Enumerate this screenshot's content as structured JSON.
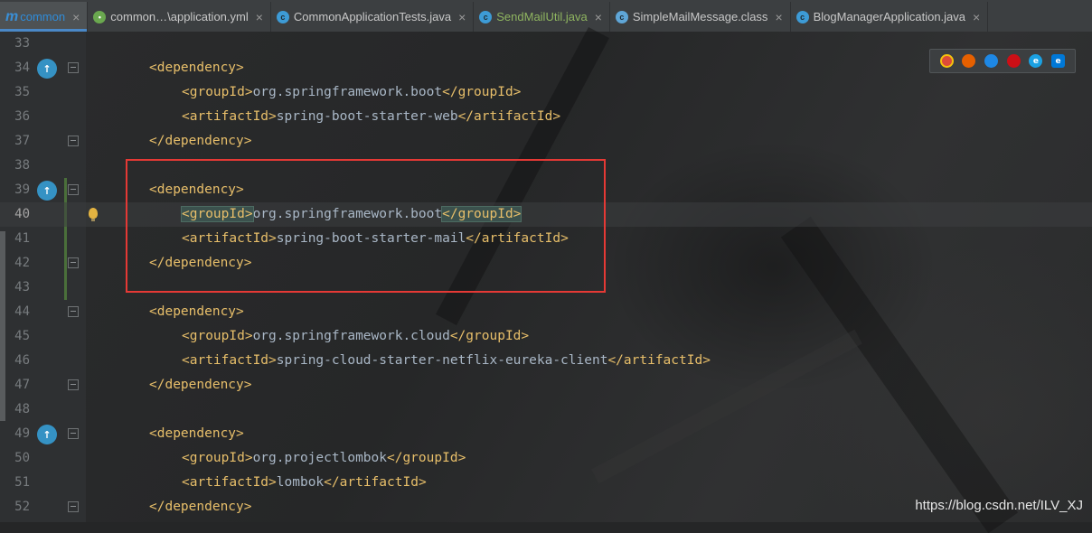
{
  "tabs": [
    {
      "label": "common",
      "icon": "maven-icon"
    },
    {
      "label": "common…\\application.yml",
      "icon": "spring-leaf-icon"
    },
    {
      "label": "CommonApplicationTests.java",
      "icon": "class-icon"
    },
    {
      "label": "SendMailUtil.java",
      "icon": "class-icon"
    },
    {
      "label": "SimpleMessage.class",
      "icon": "class-file-icon"
    },
    {
      "label": "BlogManagerApplication.java",
      "icon": "class-icon"
    }
  ],
  "tabs_fix": {
    "simple": "SimpleMailMessage.class"
  },
  "close_glyph": "×",
  "line_numbers": [
    "33",
    "34",
    "35",
    "36",
    "37",
    "38",
    "39",
    "40",
    "41",
    "42",
    "43",
    "44",
    "45",
    "46",
    "47",
    "48",
    "49",
    "50",
    "51",
    "52"
  ],
  "tags": {
    "dependency": "dependency",
    "groupId": "groupId",
    "artifactId": "artifactId"
  },
  "deps": [
    {
      "groupId": "org.springframework.boot",
      "artifactId": "spring-boot-starter-web"
    },
    {
      "groupId": "org.springframework.boot",
      "artifactId": "spring-boot-starter-mail"
    },
    {
      "groupId": "org.springframework.cloud",
      "artifactId": "spring-cloud-starter-netflix-eureka-client"
    },
    {
      "groupId": "org.projectlombok",
      "artifactId": "lombok"
    }
  ],
  "current_line": "40",
  "browser_icons": [
    "chrome-icon",
    "firefox-icon",
    "safari-icon",
    "opera-icon",
    "ie-icon",
    "edge-icon"
  ],
  "watermark": "https://blog.csdn.net/ILV_XJ"
}
